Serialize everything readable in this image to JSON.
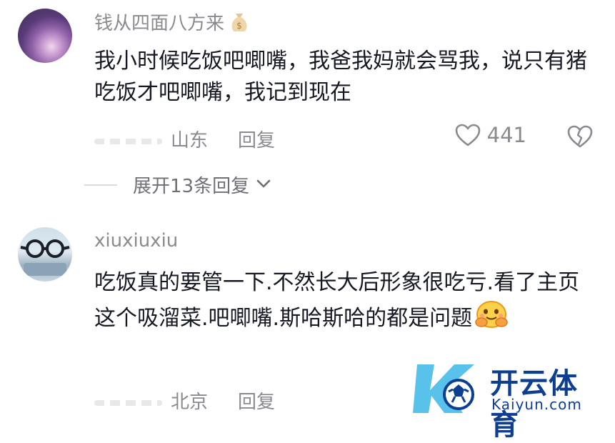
{
  "comments": [
    {
      "username": "钱从四面八方来",
      "badge_icon": "money-bag-icon",
      "text": "我小时候吃饭吧唧嘴，我爸我妈就会骂我，说只有猪吃饭才吧唧嘴，我记到现在",
      "location": "山东",
      "reply_label": "回复",
      "likes": "441"
    },
    {
      "username": "xiuxiuxiu",
      "text": "吃饭真的要管一下.不然长大后形象很吃亏.看了主页这个吸溜菜.吧唧嘴.斯哈斯哈的都是问题",
      "sticker_icon": "hug-emoji-icon",
      "location": "北京",
      "reply_label": "回复"
    }
  ],
  "expand_replies": "展开13条回复",
  "watermark": {
    "cn": "开云体育",
    "en": "Kaiyun.com"
  },
  "colors": {
    "text": "#161823",
    "secondary": "#8a8b91",
    "watermark": "#0e3e8f",
    "watermark_light": "#3cb7e8"
  }
}
